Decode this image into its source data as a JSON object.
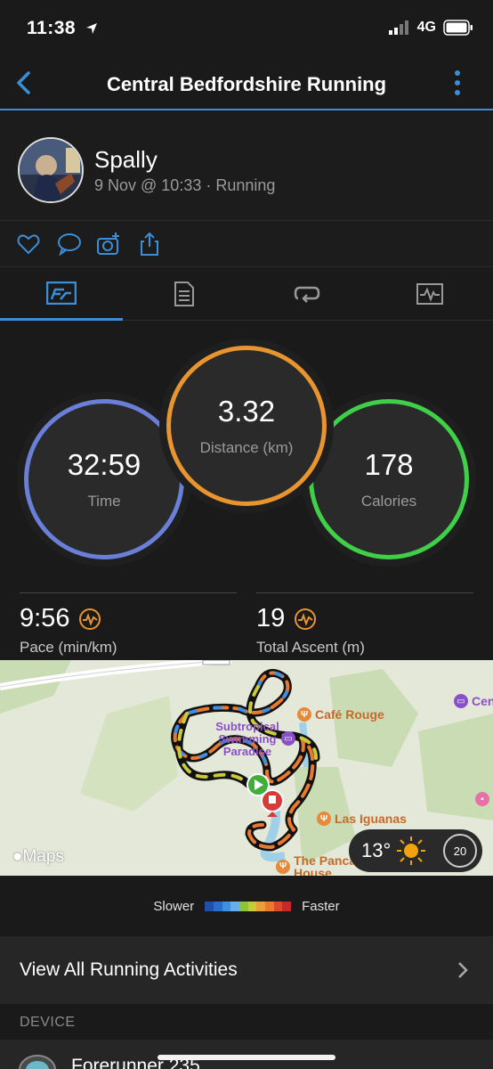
{
  "status_bar": {
    "time": "11:38",
    "network": "4G"
  },
  "nav": {
    "title": "Central Bedfordshire Running"
  },
  "profile": {
    "name": "Spally",
    "meta": "9 Nov @ 10:33 · Running"
  },
  "social": {
    "icons": [
      "heart-icon",
      "comment-icon",
      "add-photo-icon",
      "share-icon"
    ]
  },
  "tabs": {
    "icons": [
      "stats-icon",
      "details-icon",
      "laps-icon",
      "charts-icon"
    ],
    "active": 0
  },
  "stats": {
    "time": {
      "value": "32:59",
      "label": "Time"
    },
    "distance": {
      "value": "3.32",
      "label": "Distance (km)"
    },
    "calories": {
      "value": "178",
      "label": "Calories"
    }
  },
  "metrics": {
    "pace": {
      "value": "9:56",
      "label": "Pace (min/km)"
    },
    "ascent": {
      "value": "19",
      "label": "Total Ascent (m)"
    }
  },
  "map": {
    "labels": {
      "poi1": "Subtropical",
      "poi1b": "Swimming",
      "poi1c": "Paradise",
      "cafe": "Café Rouge",
      "iguanas": "Las Iguanas",
      "pancake": "The Panca",
      "pancake2": "House",
      "cen": "Cen"
    },
    "attribution": "Maps",
    "weather": {
      "temp": "13°",
      "wind": "20"
    }
  },
  "legend": {
    "slower": "Slower",
    "faster": "Faster",
    "colors": [
      "#1f4fa8",
      "#2d6cc8",
      "#3f8ee0",
      "#6aaee8",
      "#8fc43a",
      "#c9c93a",
      "#e8a03a",
      "#e87a30",
      "#d84a2a",
      "#c42a2a"
    ]
  },
  "view_all": {
    "label": "View All Running Activities"
  },
  "device_section": {
    "header": "DEVICE",
    "device_name": "Forerunner 235"
  },
  "colors": {
    "accent": "#3a8fd8",
    "time_ring": "#6a7fd8",
    "distance_ring": "#e8952f",
    "calories_ring": "#3fd048"
  }
}
